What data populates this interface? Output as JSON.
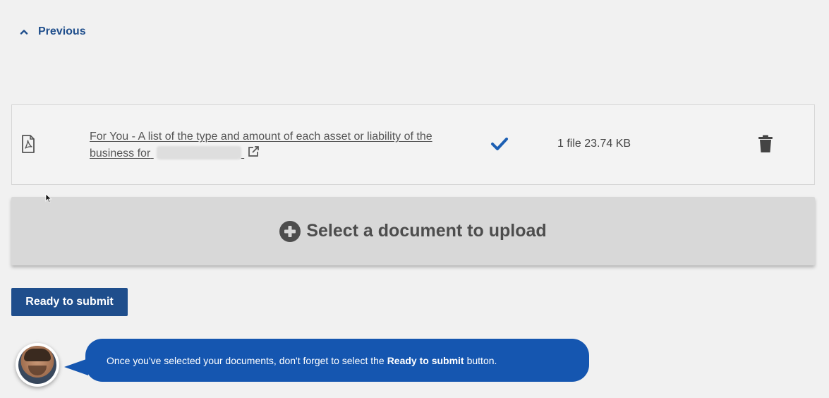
{
  "nav": {
    "previous_label": "Previous",
    "previous_icon": "chevron-up-icon"
  },
  "document": {
    "file_icon": "pdf-file-icon",
    "link_text": "For You - A list of the type and amount of each asset or liability of the business for",
    "external_icon": "external-link-icon",
    "status_icon": "checkmark-icon",
    "file_info": "1 file 23.74 KB",
    "delete_icon": "trash-icon"
  },
  "upload": {
    "label": "Select a document to upload",
    "icon": "plus-circle-icon"
  },
  "submit": {
    "label": "Ready to submit"
  },
  "assistant": {
    "avatar": "assistant-avatar",
    "message_before": "Once you've selected your documents, don't forget to select the",
    "message_bold": "Ready to submit",
    "message_after": "button."
  },
  "colors": {
    "primary": "#1f4e8c",
    "bubble": "#1556b0",
    "check": "#1c5fb3",
    "background": "#f1f1f1",
    "upload_bg": "#d8d8d8"
  }
}
